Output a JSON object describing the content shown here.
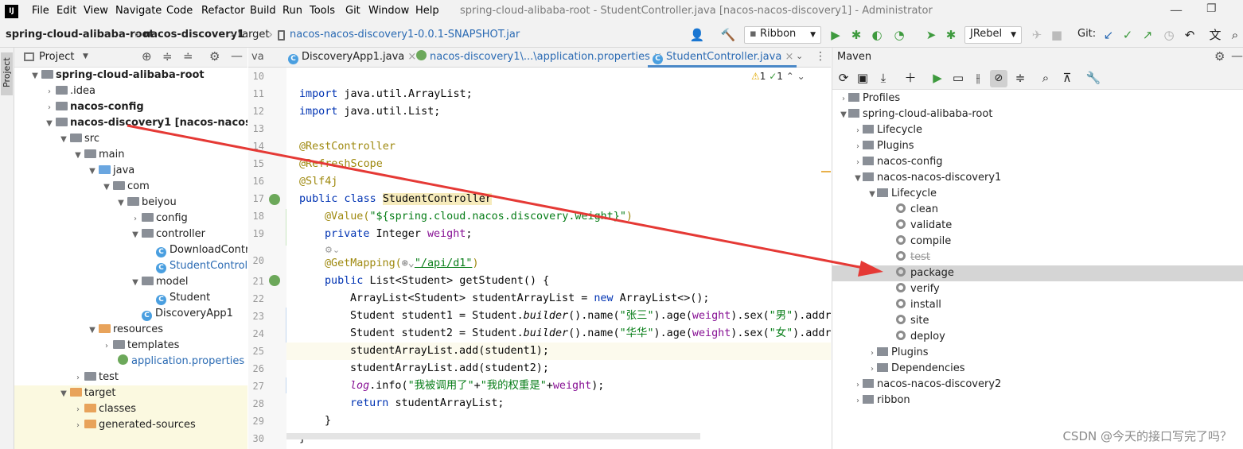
{
  "menubar": {
    "logo": "IJ",
    "items": [
      "File",
      "Edit",
      "View",
      "Navigate",
      "Code",
      "Refactor",
      "Build",
      "Run",
      "Tools",
      "Git",
      "Window",
      "Help"
    ],
    "window_title": "spring-cloud-alibaba-root - StudentController.java [nacos-nacos-discovery1] - Administrator"
  },
  "breadcrumb": {
    "root": "spring-cloud-alibaba-root",
    "module": "nacos-discovery1",
    "folder": "target",
    "jar": "nacos-nacos-discovery1-0.0.1-SNAPSHOT.jar"
  },
  "toolbar": {
    "run_config": "Ribbon",
    "jrebel": "JRebel",
    "git_label": "Git:"
  },
  "project_panel": {
    "title": "Project",
    "tree": [
      {
        "label": "spring-cloud-alibaba-root",
        "bold": true
      },
      {
        "label": ".idea"
      },
      {
        "label": "nacos-config",
        "bold": true
      },
      {
        "label": "nacos-discovery1 [nacos-nacos-discove"
      },
      {
        "label": "src"
      },
      {
        "label": "main"
      },
      {
        "label": "java"
      },
      {
        "label": "com"
      },
      {
        "label": "beiyou"
      },
      {
        "label": "config"
      },
      {
        "label": "controller"
      },
      {
        "label": "DownloadControlle"
      },
      {
        "label": "StudentController"
      },
      {
        "label": "model"
      },
      {
        "label": "Student"
      },
      {
        "label": "DiscoveryApp1"
      },
      {
        "label": "resources"
      },
      {
        "label": "templates"
      },
      {
        "label": "application.properties"
      },
      {
        "label": "test"
      },
      {
        "label": "target"
      },
      {
        "label": "classes"
      },
      {
        "label": "generated-sources"
      }
    ]
  },
  "editor": {
    "tabs": [
      "va",
      "DiscoveryApp1.java",
      "nacos-discovery1\\...\\application.properties",
      "StudentController.java"
    ],
    "warnings": "1",
    "weak_warnings": "1",
    "line_numbers": [
      "10",
      "11",
      "12",
      "13",
      "14",
      "15",
      "16",
      "17",
      "18",
      "19",
      "20",
      "21",
      "22",
      "23",
      "24",
      "25",
      "26",
      "27",
      "28",
      "29",
      "30"
    ],
    "code": {
      "l11a": "import",
      "l11b": " java.util.ArrayList;",
      "l12a": "import",
      "l12b": " java.util.List;",
      "l14": "@RestController",
      "l15": "@RefreshScope",
      "l16": "@Slf4j",
      "l17a": "public class ",
      "l17b": "StudentController",
      " l17c": " {",
      "l18a": "@Value(",
      "l18b": "\"${spring.cloud.nacos.discovery.weight}\"",
      "l18c": ")",
      "l19a": "private ",
      "l19b": "Integer ",
      "l19c": "weight",
      ";": ";",
      "l20": "@GetMapping(",
      "l20b": "\"/api/d1\"",
      "l20c": ")",
      "l21a": "public ",
      "l21b": "List<Student> getStudent() {",
      "l22a": "ArrayList<Student> studentArrayList = ",
      "l22b": "new ",
      "l22c": "ArrayList<>();",
      "l23a": "Student student1 = Student.",
      "l23b": "builder",
      "l23c": "().name(",
      "l23d": "\"张三\"",
      "l23e": ").age(",
      "l23f": "weight",
      "l23g": ").sex(",
      "l23h": "\"男\"",
      "l23i": ").addre",
      "l24a": "Student student2 = Student.",
      "l24b": "builder",
      "l24c": "().name(",
      "l24d": "\"华华\"",
      "l24e": ").age(",
      "l24f": "weight",
      "l24g": ").sex(",
      "l24h": "\"女\"",
      "l24i": ").addre",
      "l25": "studentArrayList.add(student1);",
      "l26": "studentArrayList.add(student2);",
      "l27a": "log",
      ".info": ".info(",
      "l27b": "\"我被调用了\"",
      "l27c": "+",
      "l27d": "\"我的权重是\"",
      "l27e": "+",
      "l27f": "weight",
      "l27g": ");",
      "l28a": "return ",
      "l28b": "studentArrayList;",
      "l29": "}",
      "l30": "}"
    }
  },
  "maven": {
    "title": "Maven",
    "tree": [
      {
        "label": "Profiles"
      },
      {
        "label": "spring-cloud-alibaba-root"
      },
      {
        "label": "Lifecycle"
      },
      {
        "label": "Plugins"
      },
      {
        "label": "nacos-config"
      },
      {
        "label": "nacos-nacos-discovery1"
      },
      {
        "label": "Lifecycle"
      },
      {
        "label": "clean"
      },
      {
        "label": "validate"
      },
      {
        "label": "compile"
      },
      {
        "label": "test"
      },
      {
        "label": "package"
      },
      {
        "label": "verify"
      },
      {
        "label": "install"
      },
      {
        "label": "site"
      },
      {
        "label": "deploy"
      },
      {
        "label": "Plugins"
      },
      {
        "label": "Dependencies"
      },
      {
        "label": "nacos-nacos-discovery2"
      },
      {
        "label": "ribbon"
      }
    ]
  },
  "strip_label": "Project",
  "watermark": "CSDN @今天的接口写完了吗？",
  "colors": {
    "arrow": "#e53935",
    "accent": "#2a6ab3",
    "selection": "#d5d5d5"
  }
}
